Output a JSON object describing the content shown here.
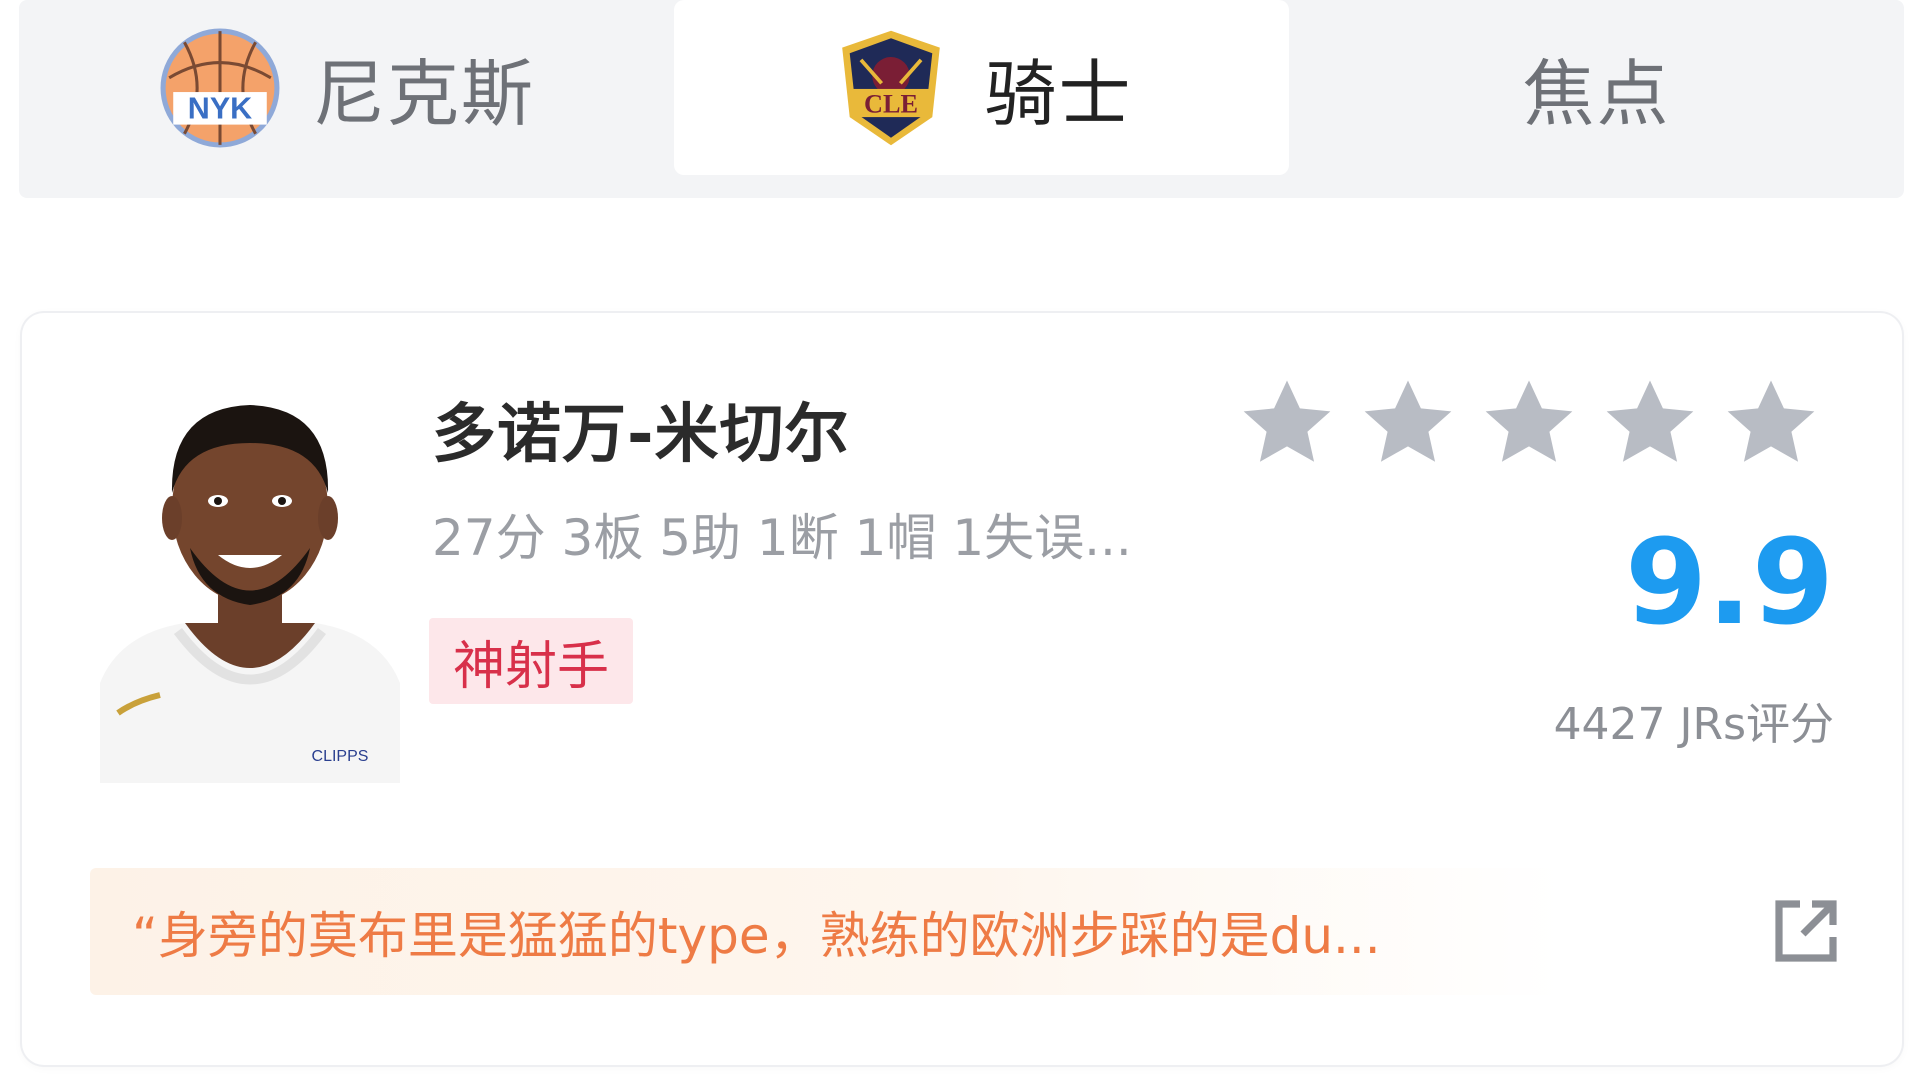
{
  "tabs": [
    {
      "team": "knicks",
      "label": "尼克斯",
      "logo_text": "NYK",
      "active": false
    },
    {
      "team": "cavaliers",
      "label": "骑士",
      "logo_text": "CLE",
      "active": true
    },
    {
      "team": "focus",
      "label": "焦点",
      "active": false
    }
  ],
  "player_card": {
    "name": "多诺万-米切尔",
    "stats_line": "27分 3板 5助 1断 1帽 1失误...",
    "badge": "神射手",
    "jersey_text": "CLIPPS",
    "stars": {
      "count": 5,
      "filled": 0,
      "color": "#b8bcc4"
    },
    "score": "9.9",
    "votes": "4427 JRs评分",
    "quote": "“身旁的莫布里是猛猛的type，熟练的欧洲步踩的是du...",
    "share_icon": "external-link-icon"
  },
  "colors": {
    "score": "#1d9bf0",
    "badge_text": "#d8304a",
    "badge_bg": "#fde7ea",
    "quote_text": "#ee7b45",
    "tab_bg": "#f3f4f6"
  }
}
